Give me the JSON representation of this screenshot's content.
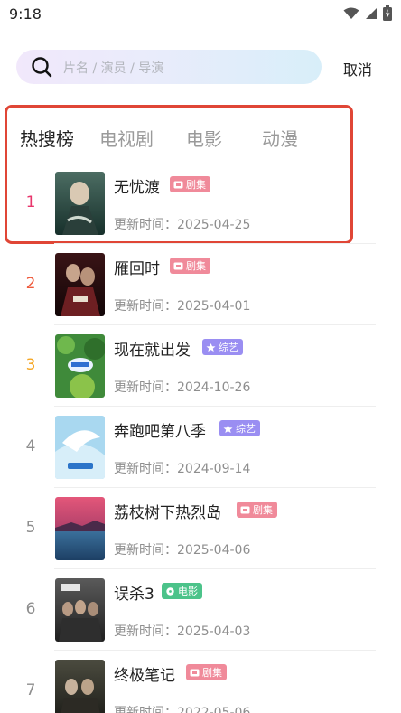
{
  "status_bar": {
    "time": "9:18",
    "icons": [
      "wifi-icon",
      "signal-icon",
      "battery-icon"
    ]
  },
  "search": {
    "placeholder": "片名 / 演员 / 导演",
    "cancel_label": "取消"
  },
  "tabs": [
    {
      "label": "热搜榜",
      "active": true
    },
    {
      "label": "电视剧",
      "active": false
    },
    {
      "label": "电影",
      "active": false
    },
    {
      "label": "动漫",
      "active": false
    }
  ],
  "colors": {
    "highlight_border": "#e04636",
    "rank_1": "#e8366c",
    "rank_2": "#ef5a3c",
    "rank_3": "#f5a623",
    "rank_other": "#8e8e8e",
    "badge_drama": "#f08a9a",
    "badge_variety": "#9a8ef2",
    "badge_movie": "#4cc38a"
  },
  "list": [
    {
      "rank": "1",
      "title": "无忧渡",
      "badge": "剧集",
      "badge_type": "drama",
      "updated": "更新时间：2025-04-25"
    },
    {
      "rank": "2",
      "title": "雁回时",
      "badge": "剧集",
      "badge_type": "drama",
      "updated": "更新时间：2025-04-01"
    },
    {
      "rank": "3",
      "title": "现在就出发",
      "badge": "综艺",
      "badge_type": "variety",
      "updated": "更新时间：2024-10-26"
    },
    {
      "rank": "4",
      "title": "奔跑吧第八季",
      "badge": "综艺",
      "badge_type": "variety",
      "updated": "更新时间：2024-09-14"
    },
    {
      "rank": "5",
      "title": "荔枝树下热烈岛",
      "badge": "剧集",
      "badge_type": "drama",
      "updated": "更新时间：2025-04-06"
    },
    {
      "rank": "6",
      "title": "误杀3",
      "badge": "电影",
      "badge_type": "movie",
      "updated": "更新时间：2025-04-03"
    },
    {
      "rank": "7",
      "title": "终极笔记",
      "badge": "剧集",
      "badge_type": "drama",
      "updated": "更新时间：2022-05-06"
    }
  ]
}
